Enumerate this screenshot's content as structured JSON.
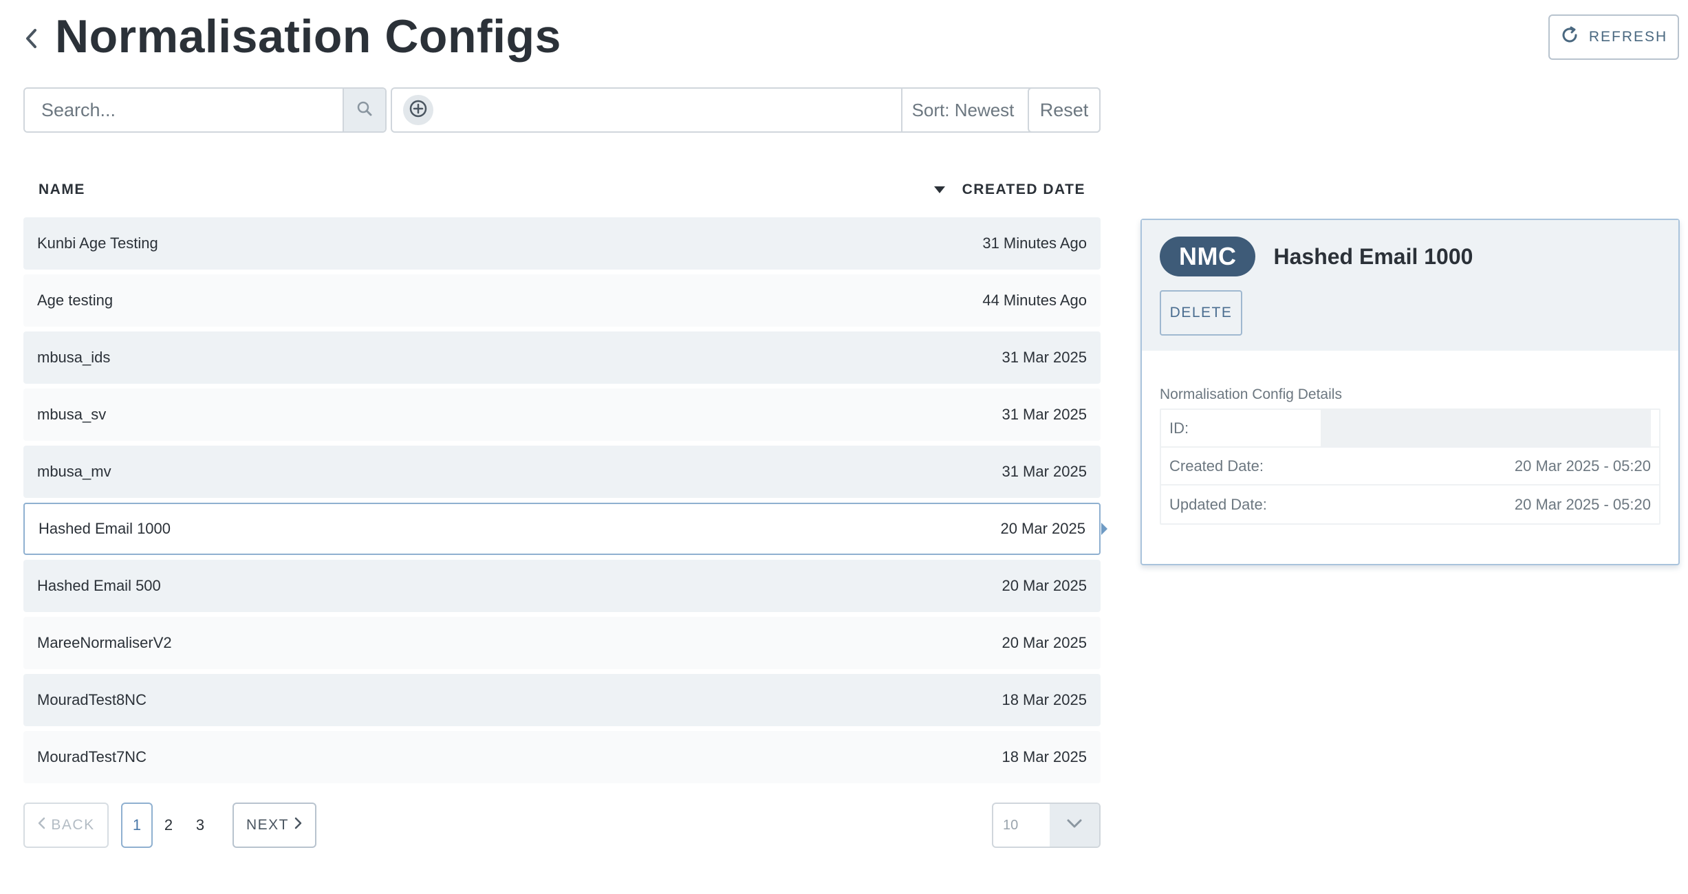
{
  "header": {
    "title": "Normalisation Configs",
    "refresh_label": "REFRESH"
  },
  "toolbar": {
    "search_placeholder": "Search...",
    "sort_label": "Sort: Newest",
    "reset_label": "Reset"
  },
  "table": {
    "col_name": "NAME",
    "col_created": "CREATED DATE",
    "rows": [
      {
        "name": "Kunbi Age Testing",
        "created": "31 Minutes Ago"
      },
      {
        "name": "Age testing",
        "created": "44 Minutes Ago"
      },
      {
        "name": "mbusa_ids",
        "created": "31 Mar 2025"
      },
      {
        "name": "mbusa_sv",
        "created": "31 Mar 2025"
      },
      {
        "name": "mbusa_mv",
        "created": "31 Mar 2025"
      },
      {
        "name": "Hashed Email 1000",
        "created": "20 Mar 2025"
      },
      {
        "name": "Hashed Email 500",
        "created": "20 Mar 2025"
      },
      {
        "name": "MareeNormaliserV2",
        "created": "20 Mar 2025"
      },
      {
        "name": "MouradTest8NC",
        "created": "18 Mar 2025"
      },
      {
        "name": "MouradTest7NC",
        "created": "18 Mar 2025"
      }
    ],
    "selected_index": 5
  },
  "pagination": {
    "back_label": "BACK",
    "next_label": "NEXT",
    "pages": [
      "1",
      "2",
      "3"
    ],
    "current_page": "1",
    "page_size": "10"
  },
  "detail": {
    "badge": "NMC",
    "name": "Hashed Email 1000",
    "delete_label": "DELETE",
    "section_label": "Normalisation Config Details",
    "id_label": "ID:",
    "created_label": "Created Date:",
    "created_value": "20 Mar 2025 - 05:20",
    "updated_label": "Updated Date:",
    "updated_value": "20 Mar 2025 - 05:20"
  },
  "colors": {
    "accent": "#3e5b78",
    "link": "#4a6880",
    "row_alt": "#eef2f5",
    "selected_border": "#8fb0d0"
  },
  "icons": {
    "back": "chevron-left-icon",
    "refresh": "refresh-icon",
    "search": "search-icon",
    "add": "plus-circle-icon",
    "sort": "sort-down-icon",
    "dropdown": "chevron-down-icon"
  }
}
